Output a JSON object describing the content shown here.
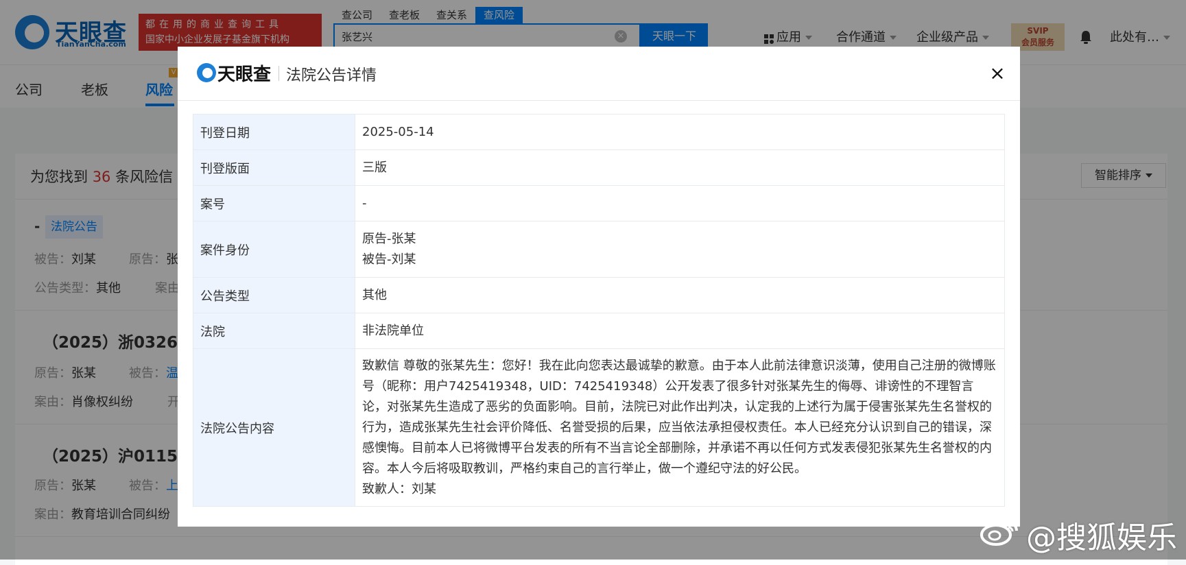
{
  "header": {
    "logo_text": "天眼查",
    "logo_sub": "TianYanCha.com",
    "slogan_line1": "都在用的商业查询工具",
    "slogan_line2": "国家中小企业发展子基金旗下机构",
    "search_tabs": [
      "查公司",
      "查老板",
      "查关系",
      "查风险"
    ],
    "search_value": "张艺兴",
    "search_button": "天眼一下",
    "nav": {
      "apps": "应用",
      "partner": "合作通道",
      "enterprise": "企业级产品",
      "svip_line1": "SVIP",
      "svip_line2": "会员服务",
      "user": "此处有…"
    }
  },
  "subnav": {
    "tabs": [
      "公司",
      "老板",
      "风险"
    ],
    "badge": "V"
  },
  "results": {
    "found_prefix": "为您找到",
    "found_count": "36",
    "found_suffix": "条风险信",
    "sort_label": "智能排序",
    "item1": {
      "dash": "-",
      "tag": "法院公告",
      "defendant_label": "被告：",
      "defendant": "刘某",
      "plaintiff_label": "原告：",
      "plaintiff_partial": "张",
      "type_label": "公告类型：",
      "type": "其他",
      "cause_label_partial": "案由"
    },
    "item2": {
      "title_partial": "（2025）浙0326民",
      "plaintiff_label": "原告：",
      "plaintiff": "张某",
      "defendant_label": "被告：",
      "defendant_partial": "温",
      "cause_label": "案由：",
      "cause": "肖像权纠纷",
      "extra_partial": "开"
    },
    "item3": {
      "title_partial": "（2025）沪0115民",
      "plaintiff_label": "原告：",
      "plaintiff": "张某",
      "defendant_label": "被告：",
      "defendant_partial": "上",
      "cause_label": "案由：",
      "cause": "教育培训合同纠纷"
    }
  },
  "modal": {
    "logo_text": "天眼查",
    "title": "法院公告详情",
    "close": "×",
    "rows": {
      "date_label": "刊登日期",
      "date_value": "2025-05-14",
      "page_label": "刊登版面",
      "page_value": "三版",
      "case_no_label": "案号",
      "case_no_value": "-",
      "identity_label": "案件身份",
      "identity_line1": "原告-张某",
      "identity_line2": "被告-刘某",
      "type_label": "公告类型",
      "type_value": "其他",
      "court_label": "法院",
      "court_value": "非法院单位",
      "content_label": "法院公告内容",
      "content_value": "致歉信 尊敬的张某先生：您好！我在此向您表达最诚挚的歉意。由于本人此前法律意识淡薄，使用自己注册的微博账号（昵称：用户7425419348，UID：7425419348）公开发表了很多针对张某先生的侮辱、诽谤性的不理智言论，对张某先生造成了恶劣的负面影响。目前，法院已对此作出判决，认定我的上述行为属于侵害张某先生名誉权的行为，造成张某先生社会评价降低、名誉受损的后果，应当依法承担侵权责任。本人已经充分认识到自己的错误，深感懊悔。目前本人已将微博平台发表的所有不当言论全部删除，并承诺不再以任何方式发表侵犯张某先生名誉权的内容。本人今后将吸取教训，严格约束自己的言行举止，做一个遵纪守法的好公民。",
      "content_signature": "致歉人：刘某"
    }
  },
  "watermark": {
    "text": "@搜狐娱乐"
  },
  "colors": {
    "brand_blue": "#0084ff",
    "slogan_red": "#d9322e",
    "count_red": "#e02f2f",
    "label_bg": "#edf4fd"
  }
}
